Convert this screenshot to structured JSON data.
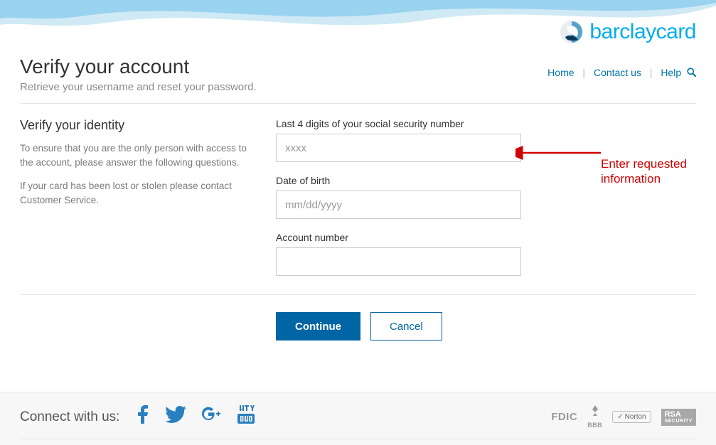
{
  "brand": {
    "name": "barclaycard"
  },
  "nav": {
    "home": "Home",
    "contact": "Contact us",
    "help": "Help"
  },
  "header": {
    "title": "Verify your account",
    "subtitle": "Retrieve your username and reset your password."
  },
  "sidebar": {
    "heading": "Verify your identity",
    "p1": "To ensure that you are the only person with access to the account, please answer the following questions.",
    "p2": "If your card has been lost or stolen please contact Customer Service."
  },
  "form": {
    "ssn": {
      "label": "Last 4 digits of your social security number",
      "placeholder": "xxxx",
      "value": ""
    },
    "dob": {
      "label": "Date of birth",
      "placeholder": "mm/dd/yyyy",
      "value": ""
    },
    "acct": {
      "label": "Account number",
      "placeholder": "",
      "value": ""
    }
  },
  "buttons": {
    "continue": "Continue",
    "cancel": "Cancel"
  },
  "annotation": {
    "line1": "Enter requested",
    "line2": "information"
  },
  "footer": {
    "connect_label": "Connect with us:",
    "badges": {
      "fdic": "FDIC",
      "bbb": "BBB",
      "norton": "Norton",
      "rsa_top": "RSA",
      "rsa_bot": "SECURITY"
    }
  }
}
